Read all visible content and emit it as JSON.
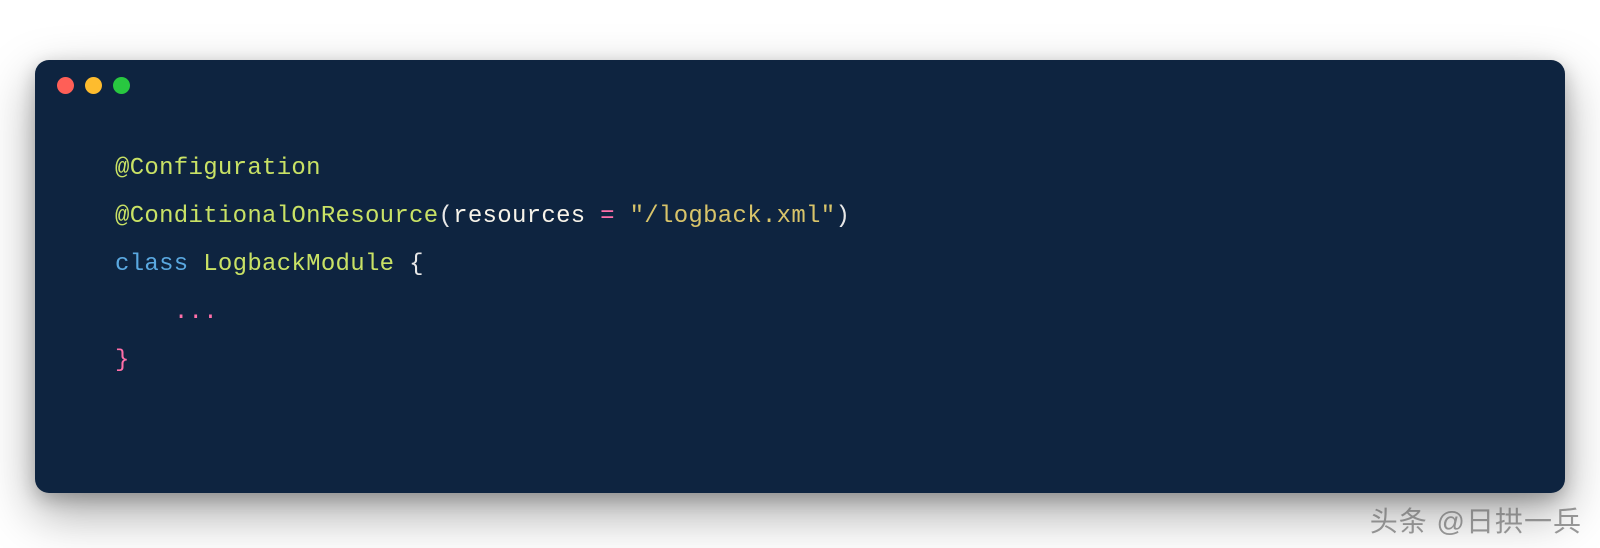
{
  "code": {
    "line1": {
      "annotation": "@Configuration"
    },
    "line2": {
      "annotation": "@ConditionalOnResource",
      "open": "(",
      "param": "resources",
      "operator": " = ",
      "string": "\"/logback.xml\"",
      "close": ")"
    },
    "line3": {
      "keyword": "class",
      "space": " ",
      "classname": "LogbackModule",
      "space2": " ",
      "brace": "{"
    },
    "line4": {
      "indent": "    ",
      "ellipsis": "..."
    },
    "line5": {
      "closebrace": "}"
    }
  },
  "watermark": "头条 @日拱一兵"
}
